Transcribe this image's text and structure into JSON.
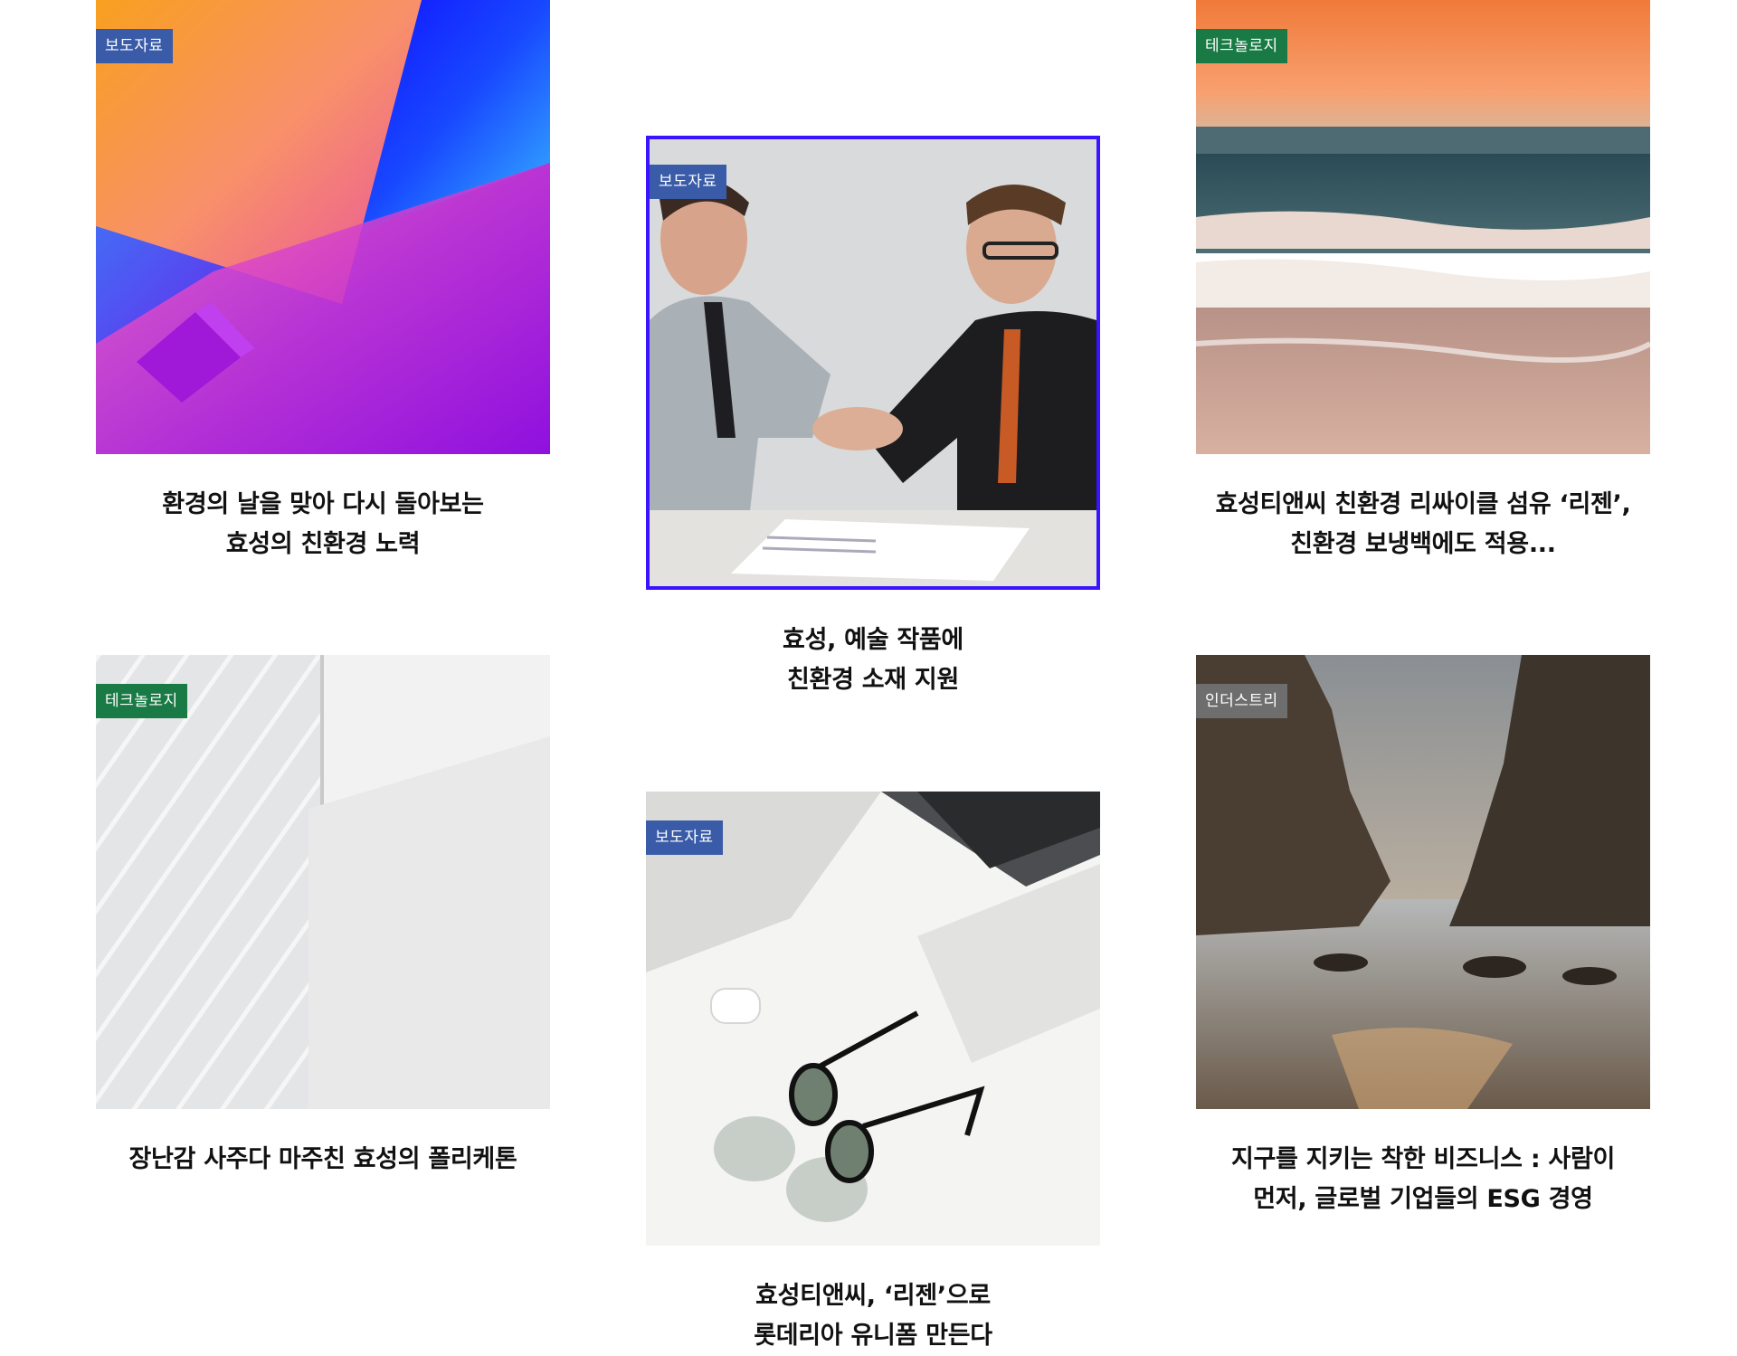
{
  "cards": [
    {
      "category": "보도자료",
      "badge_color": "#3a5ba7",
      "title_lines": [
        "환경의 날을 맞아 다시 돌아보는",
        "효성의 친환경 노력"
      ]
    },
    {
      "category": "보도자료",
      "badge_color": "#3a5ba7",
      "title_lines": [
        "효성, 예술 작품에",
        "친환경 소재 지원"
      ]
    },
    {
      "category": "테크놀로지",
      "badge_color": "#1a7a45",
      "title_lines": [
        "효성티앤씨 친환경 리싸이클 섬유 ‘리젠’,",
        "친환경 보냉백에도 적용..."
      ]
    },
    {
      "category": "테크놀로지",
      "badge_color": "#1a7a45",
      "title_lines": [
        "장난감 사주다 마주친 효성의 폴리케톤"
      ]
    },
    {
      "category": "보도자료",
      "badge_color": "#3a5ba7",
      "title_lines": [
        "효성티앤씨, ‘리젠’으로",
        "롯데리아 유니폼 만든다"
      ]
    },
    {
      "category": "인더스트리",
      "badge_color": "#6e6e6e",
      "title_lines": [
        "지구를 지키는 착한 비즈니스 : 사람이",
        "먼저, 글로벌 기업들의 ESG 경영"
      ]
    }
  ]
}
